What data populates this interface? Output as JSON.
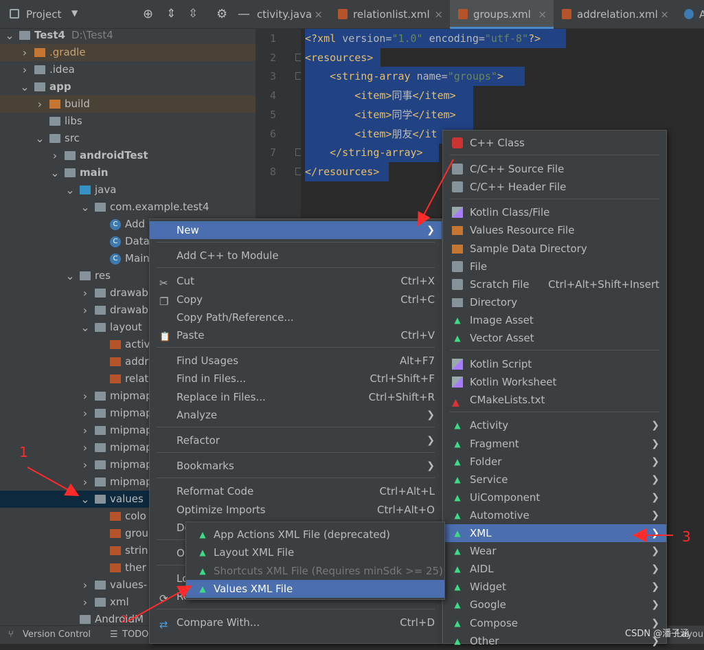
{
  "project_panel": {
    "title": "Project",
    "tree": [
      {
        "label": "Test4",
        "extra": "D:\\Test4",
        "depth": 0,
        "arrow": "⌄",
        "icon": "folder",
        "bold": true
      },
      {
        "label": ".gradle",
        "depth": 1,
        "arrow": "›",
        "icon": "folder-orange"
      },
      {
        "label": ".idea",
        "depth": 1,
        "arrow": "›",
        "icon": "folder"
      },
      {
        "label": "app",
        "depth": 1,
        "arrow": "⌄",
        "icon": "folder",
        "bold": true
      },
      {
        "label": "build",
        "depth": 2,
        "arrow": "›",
        "icon": "folder-orange"
      },
      {
        "label": "libs",
        "depth": 2,
        "arrow": "",
        "icon": "folder"
      },
      {
        "label": "src",
        "depth": 2,
        "arrow": "⌄",
        "icon": "folder"
      },
      {
        "label": "androidTest",
        "depth": 3,
        "arrow": "›",
        "icon": "folder",
        "bold": true
      },
      {
        "label": "main",
        "depth": 3,
        "arrow": "⌄",
        "icon": "folder",
        "bold": true
      },
      {
        "label": "java",
        "depth": 4,
        "arrow": "⌄",
        "icon": "folder-blue"
      },
      {
        "label": "com.example.test4",
        "depth": 5,
        "arrow": "⌄",
        "icon": "package"
      },
      {
        "label": "Add",
        "depth": 6,
        "arrow": "",
        "icon": "class"
      },
      {
        "label": "Data",
        "depth": 6,
        "arrow": "",
        "icon": "class"
      },
      {
        "label": "Main",
        "depth": 6,
        "arrow": "",
        "icon": "class"
      },
      {
        "label": "res",
        "depth": 4,
        "arrow": "⌄",
        "icon": "folder-res"
      },
      {
        "label": "drawab",
        "depth": 5,
        "arrow": "›",
        "icon": "folder"
      },
      {
        "label": "drawab",
        "depth": 5,
        "arrow": "›",
        "icon": "folder"
      },
      {
        "label": "layout",
        "depth": 5,
        "arrow": "⌄",
        "icon": "folder"
      },
      {
        "label": "activ",
        "depth": 6,
        "arrow": "",
        "icon": "xml"
      },
      {
        "label": "addr",
        "depth": 6,
        "arrow": "",
        "icon": "xml"
      },
      {
        "label": "relat",
        "depth": 6,
        "arrow": "",
        "icon": "xml"
      },
      {
        "label": "mipmap",
        "depth": 5,
        "arrow": "›",
        "icon": "folder"
      },
      {
        "label": "mipmap",
        "depth": 5,
        "arrow": "›",
        "icon": "folder"
      },
      {
        "label": "mipmap",
        "depth": 5,
        "arrow": "›",
        "icon": "folder"
      },
      {
        "label": "mipmap",
        "depth": 5,
        "arrow": "›",
        "icon": "folder"
      },
      {
        "label": "mipmap",
        "depth": 5,
        "arrow": "›",
        "icon": "folder"
      },
      {
        "label": "mipmap",
        "depth": 5,
        "arrow": "›",
        "icon": "folder"
      },
      {
        "label": "values",
        "depth": 5,
        "arrow": "⌄",
        "icon": "folder",
        "selected": true
      },
      {
        "label": "colo",
        "depth": 6,
        "arrow": "",
        "icon": "xml"
      },
      {
        "label": "grou",
        "depth": 6,
        "arrow": "",
        "icon": "xml"
      },
      {
        "label": "strin",
        "depth": 6,
        "arrow": "",
        "icon": "xml"
      },
      {
        "label": "ther",
        "depth": 6,
        "arrow": "",
        "icon": "xml"
      },
      {
        "label": "values-",
        "depth": 5,
        "arrow": "›",
        "icon": "folder"
      },
      {
        "label": "xml",
        "depth": 5,
        "arrow": "›",
        "icon": "folder"
      },
      {
        "label": "AndroidM",
        "depth": 4,
        "arrow": "",
        "icon": "manifest"
      }
    ]
  },
  "tabs": [
    {
      "label": "ctivity.java",
      "icon": "java"
    },
    {
      "label": "relationlist.xml",
      "icon": "xml"
    },
    {
      "label": "groups.xml",
      "icon": "xml",
      "active": true
    },
    {
      "label": "addrelation.xml",
      "icon": "xml"
    },
    {
      "label": "A",
      "icon": "class"
    }
  ],
  "editor": {
    "line_numbers": [
      "1",
      "2",
      "3",
      "4",
      "5",
      "6",
      "7",
      "8"
    ],
    "lines": [
      {
        "parts": [
          [
            "tg",
            "<?xml "
          ],
          [
            "at",
            "version="
          ],
          [
            "av",
            "\"1.0\""
          ],
          [
            "at",
            " encoding="
          ],
          [
            "av",
            "\"utf-8\""
          ],
          [
            "tg",
            "?>"
          ]
        ]
      },
      {
        "parts": [
          [
            "tg",
            "<resources>"
          ]
        ]
      },
      {
        "parts": [
          [
            "tx2",
            "    "
          ],
          [
            "tg",
            "<string-array "
          ],
          [
            "at",
            "name="
          ],
          [
            "av",
            "\"groups\""
          ],
          [
            "tg",
            ">"
          ]
        ]
      },
      {
        "parts": [
          [
            "tx2",
            "        "
          ],
          [
            "tg",
            "<item>"
          ],
          [
            "tx2",
            "同事"
          ],
          [
            "tg",
            "</item>"
          ]
        ]
      },
      {
        "parts": [
          [
            "tx2",
            "        "
          ],
          [
            "tg",
            "<item>"
          ],
          [
            "tx2",
            "同学"
          ],
          [
            "tg",
            "</item>"
          ]
        ]
      },
      {
        "parts": [
          [
            "tx2",
            "        "
          ],
          [
            "tg",
            "<item>"
          ],
          [
            "tx2",
            "朋友"
          ],
          [
            "tg",
            "</it"
          ]
        ]
      },
      {
        "parts": [
          [
            "tx2",
            "    "
          ],
          [
            "tg",
            "</string-array>"
          ]
        ]
      },
      {
        "parts": [
          [
            "tg",
            "</resources>"
          ]
        ]
      }
    ]
  },
  "context_menu": {
    "items": [
      {
        "label": "New",
        "submenu": true,
        "selected": true
      },
      {
        "sep": true
      },
      {
        "label": "Add C++ to Module"
      },
      {
        "sep": true
      },
      {
        "label": "Cut",
        "shortcut": "Ctrl+X",
        "icon": "cut"
      },
      {
        "label": "Copy",
        "shortcut": "Ctrl+C",
        "icon": "copy"
      },
      {
        "label": "Copy Path/Reference..."
      },
      {
        "label": "Paste",
        "shortcut": "Ctrl+V",
        "icon": "paste"
      },
      {
        "sep": true
      },
      {
        "label": "Find Usages",
        "shortcut": "Alt+F7"
      },
      {
        "label": "Find in Files...",
        "shortcut": "Ctrl+Shift+F"
      },
      {
        "label": "Replace in Files...",
        "shortcut": "Ctrl+Shift+R"
      },
      {
        "label": "Analyze",
        "submenu": true
      },
      {
        "sep": true
      },
      {
        "label": "Refactor",
        "submenu": true
      },
      {
        "sep": true
      },
      {
        "label": "Bookmarks",
        "submenu": true
      },
      {
        "sep": true
      },
      {
        "label": "Reformat Code",
        "shortcut": "Ctrl+Alt+L"
      },
      {
        "label": "Optimize Imports",
        "shortcut": "Ctrl+Alt+O"
      },
      {
        "label": "De"
      },
      {
        "sep": true
      },
      {
        "label": "O"
      },
      {
        "sep": true
      },
      {
        "label": "Lo"
      },
      {
        "label": "Re",
        "icon": "reload"
      },
      {
        "sep": true
      },
      {
        "label": "Compare With...",
        "shortcut": "Ctrl+D",
        "icon": "compare"
      }
    ]
  },
  "new_submenu": {
    "items": [
      {
        "label": "C++ Class",
        "icon": "cpp-class"
      },
      {
        "sep": true
      },
      {
        "label": "C/C++ Source File",
        "icon": "cpp-source"
      },
      {
        "label": "C/C++ Header File",
        "icon": "cpp-header"
      },
      {
        "sep": true
      },
      {
        "label": "Kotlin Class/File",
        "icon": "kotlin"
      },
      {
        "label": "Values Resource File",
        "icon": "values"
      },
      {
        "label": "Sample Data Directory",
        "icon": "folder-orange"
      },
      {
        "label": "File",
        "icon": "file"
      },
      {
        "label": "Scratch File",
        "shortcut": "Ctrl+Alt+Shift+Insert",
        "icon": "scratch"
      },
      {
        "label": "Directory",
        "icon": "folder"
      },
      {
        "label": "Image Asset",
        "icon": "android"
      },
      {
        "label": "Vector Asset",
        "icon": "android"
      },
      {
        "sep": true
      },
      {
        "label": "Kotlin Script",
        "icon": "kotlin"
      },
      {
        "label": "Kotlin Worksheet",
        "icon": "kotlin"
      },
      {
        "label": "CMakeLists.txt",
        "icon": "cmake"
      },
      {
        "sep": true
      },
      {
        "label": "Activity",
        "submenu": true,
        "icon": "android"
      },
      {
        "label": "Fragment",
        "submenu": true,
        "icon": "android"
      },
      {
        "label": "Folder",
        "submenu": true,
        "icon": "android"
      },
      {
        "label": "Service",
        "submenu": true,
        "icon": "android"
      },
      {
        "label": "UiComponent",
        "submenu": true,
        "icon": "android"
      },
      {
        "label": "Automotive",
        "submenu": true,
        "icon": "android"
      },
      {
        "label": "XML",
        "submenu": true,
        "icon": "android",
        "selected": true
      },
      {
        "label": "Wear",
        "submenu": true,
        "icon": "android"
      },
      {
        "label": "AIDL",
        "submenu": true,
        "icon": "android"
      },
      {
        "label": "Widget",
        "submenu": true,
        "icon": "android"
      },
      {
        "label": "Google",
        "submenu": true,
        "icon": "android"
      },
      {
        "label": "Compose",
        "submenu": true,
        "icon": "android"
      },
      {
        "label": "Other",
        "submenu": true,
        "icon": "android"
      }
    ]
  },
  "xml_submenu": {
    "items": [
      {
        "label": "App Actions XML File (deprecated)"
      },
      {
        "label": "Layout XML File"
      },
      {
        "label": "Shortcuts XML File (Requires minSdk >= 25)",
        "disabled": true
      },
      {
        "label": "Values XML File",
        "selected": true
      }
    ]
  },
  "status_bar": {
    "version_control": "Version Control",
    "todo": "TODO",
    "layout": "Layou"
  },
  "annotations": {
    "n1": "1",
    "n2": "2",
    "n3": "3",
    "watermark": "CSDN @潘子涵"
  },
  "colors": {
    "selection": "#214283",
    "menu_selected": "#4b6eaf",
    "arrow": "#ff2a2a"
  }
}
